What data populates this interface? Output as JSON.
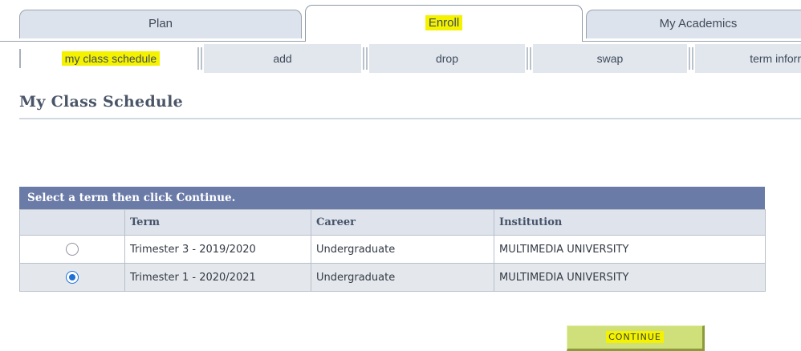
{
  "main_tabs": [
    {
      "label": "Plan",
      "active": false
    },
    {
      "label": "Enroll",
      "active": true,
      "highlighted": true
    },
    {
      "label": "My Academics",
      "active": false
    }
  ],
  "sub_tabs": [
    {
      "label": "my class schedule",
      "highlighted": true
    },
    {
      "label": "add"
    },
    {
      "label": "drop"
    },
    {
      "label": "swap"
    },
    {
      "label": "term inforr"
    }
  ],
  "page": {
    "title": "My Class Schedule"
  },
  "term_grid": {
    "caption": "Select a term then click Continue.",
    "columns": [
      "",
      "Term",
      "Career",
      "Institution"
    ],
    "rows": [
      {
        "selected": false,
        "term": "Trimester 3 - 2019/2020",
        "career": "Undergraduate",
        "institution": "MULTIMEDIA UNIVERSITY"
      },
      {
        "selected": true,
        "term": "Trimester 1 - 2020/2021",
        "career": "Undergraduate",
        "institution": "MULTIMEDIA UNIVERSITY"
      }
    ]
  },
  "continue_button": {
    "label": "CONTINUE"
  },
  "colors": {
    "highlight": "#f5f200",
    "grid_header": "#6b7ba8",
    "button": "#cfe07a",
    "radio_selected": "#1f6fd6"
  }
}
